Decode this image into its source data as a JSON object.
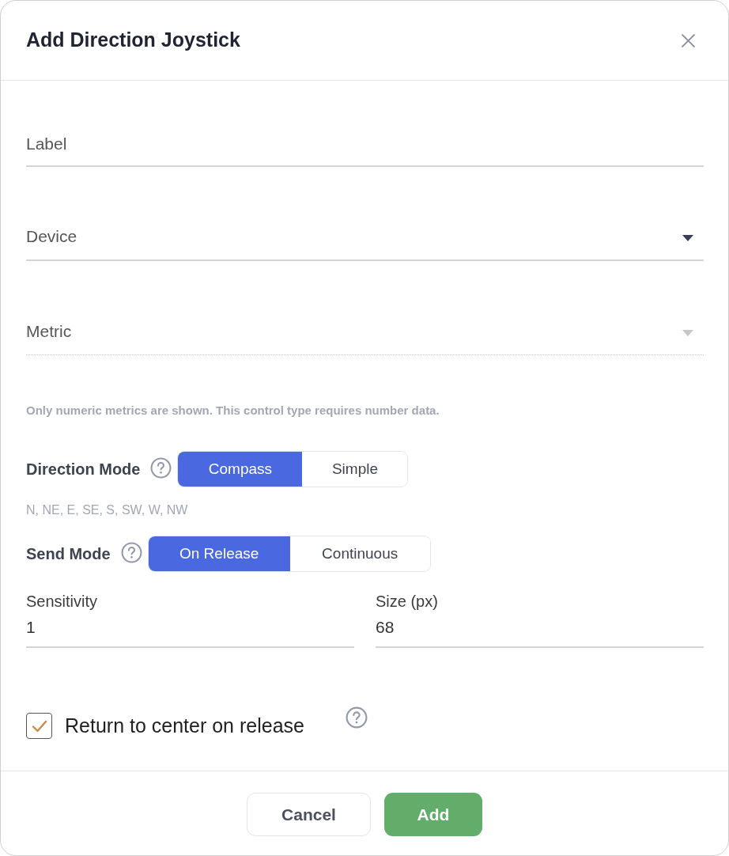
{
  "dialog": {
    "title": "Add Direction Joystick"
  },
  "fields": [
    {
      "kind": "text",
      "placeholder": "Label"
    },
    {
      "kind": "select",
      "placeholder": "Device",
      "disabled": false
    },
    {
      "kind": "select",
      "placeholder": "Metric",
      "disabled": true
    }
  ],
  "metric_hint": "Only numeric metrics are shown. This control type requires number data.",
  "modes": [
    {
      "label": "Direction Mode",
      "options": [
        {
          "label": "Compass",
          "selected": true
        },
        {
          "label": "Simple",
          "selected": false
        }
      ],
      "hint": "N, NE, E, SE, S, SW, W, NW"
    },
    {
      "label": "Send Mode",
      "options": [
        {
          "label": "On Release",
          "selected": true
        },
        {
          "label": "Continuous",
          "selected": false
        }
      ]
    }
  ],
  "number_fields": [
    {
      "label": "Sensitivity",
      "value": "1"
    },
    {
      "label": "Size (px)",
      "value": "68"
    }
  ],
  "return_to_center": {
    "label": "Return to center on release",
    "checked": true
  },
  "buttons": [
    {
      "kind": "secondary",
      "label": "Cancel"
    },
    {
      "kind": "primary",
      "label": "Add"
    }
  ]
}
